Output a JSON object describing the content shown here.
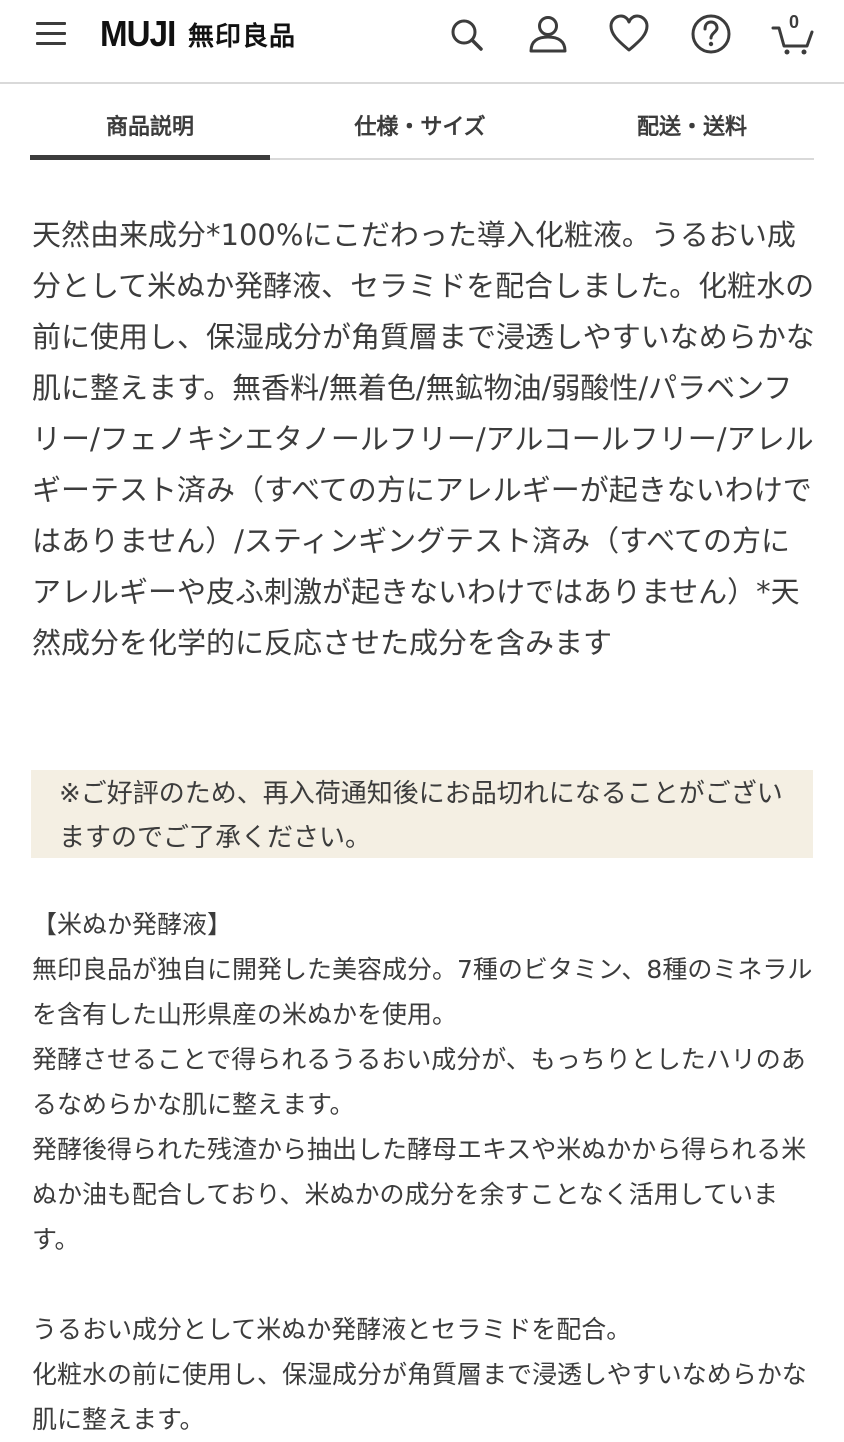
{
  "header": {
    "logo_en": "MUJI",
    "logo_jp": "無印良品",
    "cart_count": "0",
    "icons": [
      "menu-icon",
      "search-icon",
      "user-icon",
      "heart-icon",
      "help-icon",
      "cart-icon"
    ]
  },
  "tabs": [
    {
      "label": "商品説明",
      "active": true
    },
    {
      "label": "仕様・サイズ",
      "active": false
    },
    {
      "label": "配送・送料",
      "active": false
    }
  ],
  "description": "天然由来成分*100%にこだわった導入化粧液。うるおい成分として米ぬか発酵液、セラミドを配合しました。化粧水の前に使用し、保湿成分が角質層まで浸透しやすいなめらかな肌に整えます。無香料/無着色/無鉱物油/弱酸性/パラベンフリー/フェノキシエタノールフリー/アルコールフリー/アレルギーテスト済み（すべての方にアレルギーが起きないわけではありません）/スティンギングテスト済み（すべての方にアレルギーや皮ふ刺激が起きないわけではありません）*天然成分を化学的に反応させた成分を含みます",
  "notice": "※ご好評のため、再入荷通知後にお品切れになることがございますのでご了承ください。",
  "detail": {
    "heading": "【米ぬか発酵液】",
    "lines": [
      "無印良品が独自に開発した美容成分。7種のビタミン、8種のミネラルを含有した山形県産の米ぬかを使用。",
      "発酵させることで得られるうるおい成分が、もっちりとしたハリのあるなめらかな肌に整えます。",
      "発酵後得られた残渣から抽出した酵母エキスや米ぬかから得られる米ぬか油も配合しており、米ぬかの成分を余すことなく活用しています。"
    ],
    "summary": [
      "うるおい成分として米ぬか発酵液とセラミドを配合。",
      "化粧水の前に使用し、保湿成分が角質層まで浸透しやすいなめらかな肌に整えます。"
    ]
  },
  "colors": {
    "text": "#3c3c3c",
    "notice_bg": "#f4efe3",
    "divider": "#d9d9d9"
  }
}
